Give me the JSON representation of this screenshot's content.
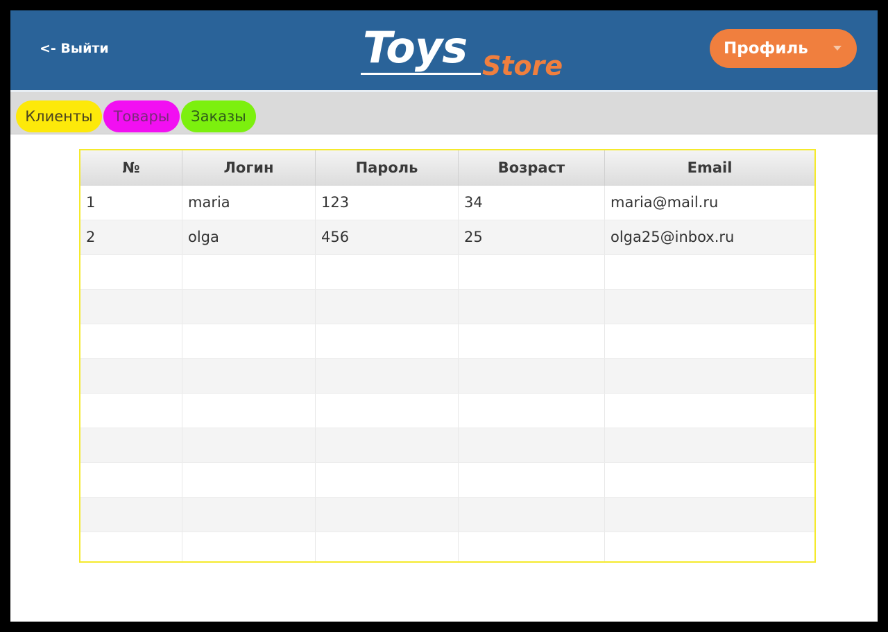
{
  "header": {
    "logout_label": "<- Выйти",
    "logo_main": "Toys",
    "logo_sub": "Store",
    "profile_label": "Профиль"
  },
  "tabs": [
    {
      "label": "Клиенты",
      "color": "#fde90a"
    },
    {
      "label": "Товары",
      "color": "#f20ff2"
    },
    {
      "label": "Заказы",
      "color": "#7cf00e"
    }
  ],
  "colors": {
    "header_bg": "#2a6399",
    "accent": "#f07f3e",
    "table_border": "#f5ea2c"
  },
  "table": {
    "columns": [
      "№",
      "Логин",
      "Пароль",
      "Возраст",
      "Email"
    ],
    "rows": [
      [
        "1",
        "maria",
        "123",
        "34",
        "maria@mail.ru"
      ],
      [
        "2",
        "olga",
        "456",
        "25",
        "olga25@inbox.ru"
      ],
      [
        "",
        "",
        "",
        "",
        ""
      ],
      [
        "",
        "",
        "",
        "",
        ""
      ],
      [
        "",
        "",
        "",
        "",
        ""
      ],
      [
        "",
        "",
        "",
        "",
        ""
      ],
      [
        "",
        "",
        "",
        "",
        ""
      ],
      [
        "",
        "",
        "",
        "",
        ""
      ],
      [
        "",
        "",
        "",
        "",
        ""
      ],
      [
        "",
        "",
        "",
        "",
        ""
      ],
      [
        "",
        "",
        "",
        "",
        ""
      ]
    ]
  }
}
